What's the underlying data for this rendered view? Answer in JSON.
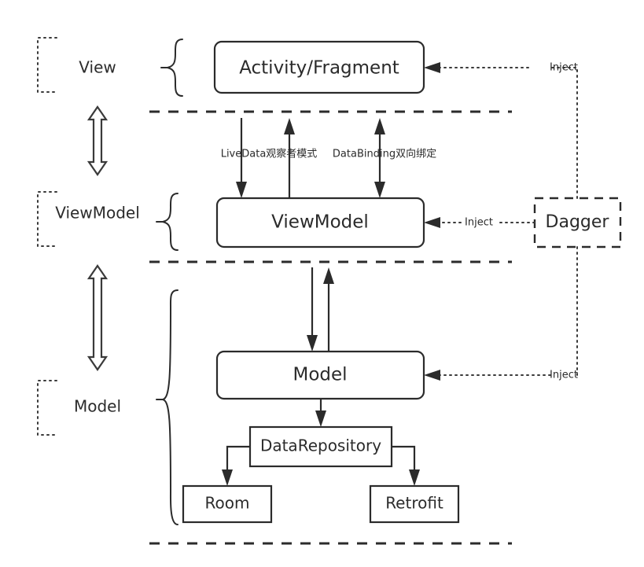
{
  "diagram": {
    "title": "Android MVVM Architecture Diagram",
    "colors": {
      "stroke": "#2b2b2b",
      "background": "#ffffff",
      "dotted": "#3a3a3a"
    },
    "layers": [
      {
        "id": "view",
        "label": "View"
      },
      {
        "id": "viewmodel",
        "label": "ViewModel"
      },
      {
        "id": "model",
        "label": "Model"
      }
    ],
    "nodes": {
      "activity_fragment": {
        "label": "Activity/Fragment",
        "shape": "rounded-rect"
      },
      "viewmodel": {
        "label": "ViewModel",
        "shape": "rounded-rect"
      },
      "model": {
        "label": "Model",
        "shape": "rounded-rect"
      },
      "data_repository": {
        "label": "DataRepository",
        "shape": "rect"
      },
      "room": {
        "label": "Room",
        "shape": "rect"
      },
      "retrofit": {
        "label": "Retrofit",
        "shape": "rect"
      },
      "dagger": {
        "label": "Dagger",
        "shape": "dashed-rect"
      }
    },
    "edge_labels": {
      "livedata": "LiveData观察者模式",
      "databinding": "DataBinding双向绑定",
      "inject_view": "Inject",
      "inject_viewmodel": "Inject",
      "inject_model": "Inject"
    }
  }
}
